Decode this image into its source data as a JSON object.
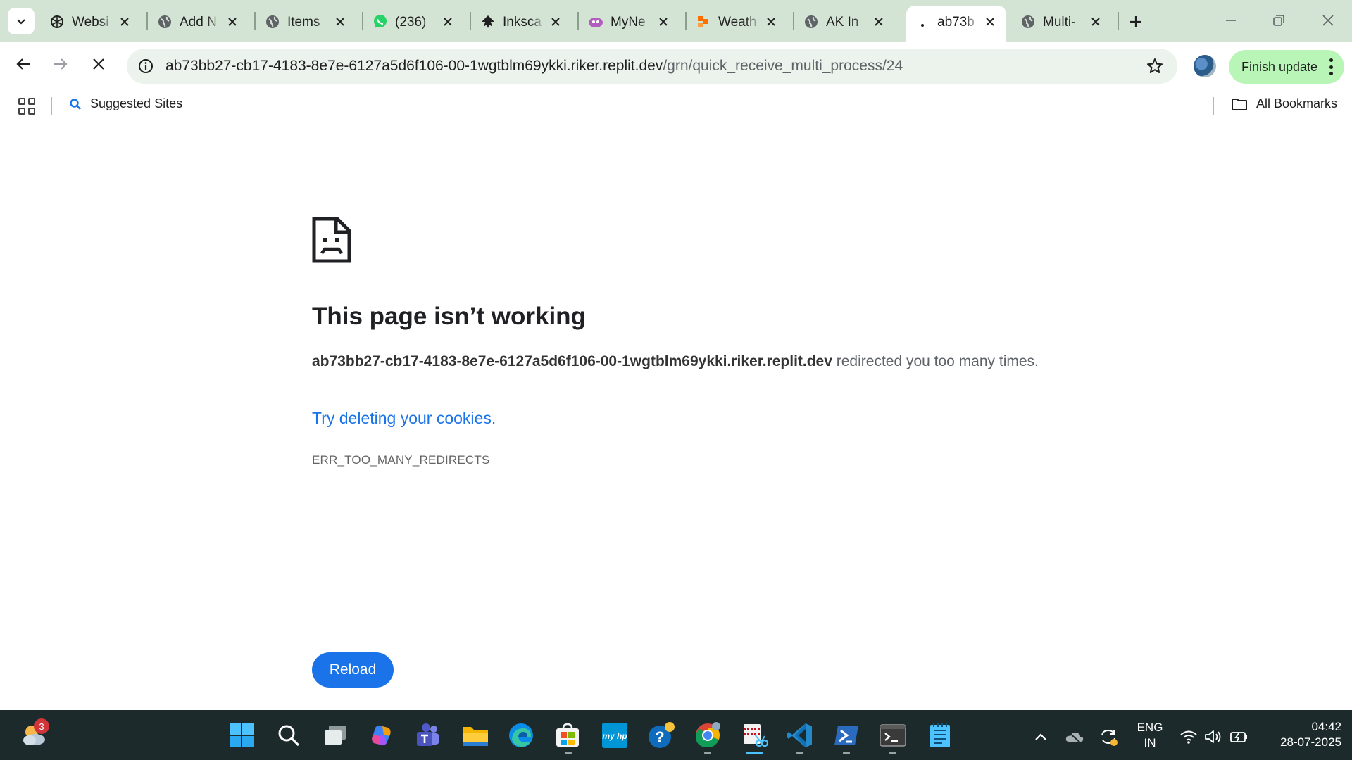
{
  "browser": {
    "tabs": [
      {
        "title": "Websi",
        "icon": "openai-icon"
      },
      {
        "title": "Add N",
        "icon": "globe-icon"
      },
      {
        "title": "Items",
        "icon": "globe-icon"
      },
      {
        "title": "(236)",
        "icon": "whatsapp-icon"
      },
      {
        "title": "Inksca",
        "icon": "inkscape-icon"
      },
      {
        "title": "MyNe",
        "icon": "mynetdiary-icon"
      },
      {
        "title": "Weath",
        "icon": "weather-icon"
      },
      {
        "title": "AK In",
        "icon": "globe-icon"
      },
      {
        "title": "ab73b",
        "icon": "loading-icon",
        "active": true
      },
      {
        "title": "Multi-",
        "icon": "globe-icon"
      }
    ],
    "address": {
      "host": "ab73bb27-cb17-4183-8e7e-6127a5d6f106-00-1wgtblm69ykki.riker.replit.dev",
      "path": "/grn/quick_receive_multi_process/24"
    },
    "finish_update_label": "Finish update",
    "bookmarks": {
      "suggested": "Suggested Sites",
      "all": "All Bookmarks"
    }
  },
  "error_page": {
    "title": "This page isn’t working",
    "host": "ab73bb27-cb17-4183-8e7e-6127a5d6f106-00-1wgtblm69ykki.riker.replit.dev",
    "message": " redirected you too many times.",
    "suggestion_link": "Try deleting your cookies",
    "suggestion_suffix": ".",
    "error_code": "ERR_TOO_MANY_REDIRECTS",
    "reload_label": "Reload"
  },
  "taskbar": {
    "weather_badge": "3",
    "language": "ENG",
    "region": "IN",
    "time": "04:42",
    "date": "28-07-2025"
  },
  "colors": {
    "tabstrip_bg": "#d3e3d4",
    "link_blue": "#1a73e8",
    "finish_update_bg": "#b9f5b7",
    "taskbar_bg": "#1c2a2c"
  }
}
